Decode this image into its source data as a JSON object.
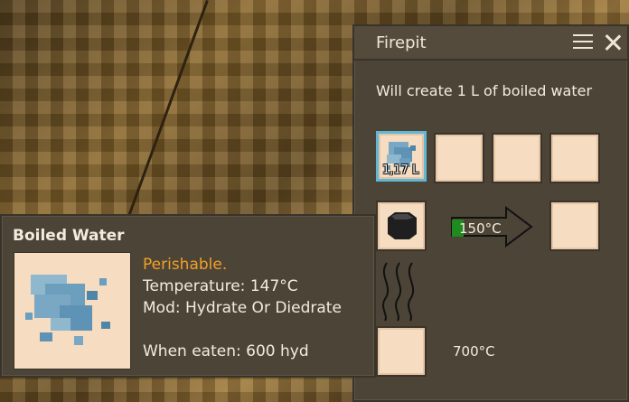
{
  "dialog": {
    "title": "Firepit",
    "info_text": "Will create 1 L of boiled water",
    "input_slot": {
      "quantity": "1,17 L",
      "item_icon": "water-puddle-icon"
    },
    "fuel_slot": {
      "item_icon": "coal-icon"
    },
    "cook_temperature": "150°C",
    "fuel_temperature": "700°C",
    "menu_icon": "hamburger-menu-icon",
    "close_icon": "close-icon",
    "heat_icon": "heat-waves-icon",
    "progress_arrow_icon": "arrow-right-icon"
  },
  "tooltip": {
    "title": "Boiled Water",
    "perishable": "Perishable.",
    "temperature": "Temperature: 147°C",
    "mod": "Mod: Hydrate Or Diedrate",
    "when_eaten": "When eaten: 600 hyd",
    "item_icon": "water-puddle-icon"
  },
  "colors": {
    "panel": "#4c4437",
    "slot": "#f6dcc0",
    "active_slot_border": "#61b7d6",
    "perishable_text": "#f0a02a",
    "temp_bar": "#1f8a1f"
  }
}
